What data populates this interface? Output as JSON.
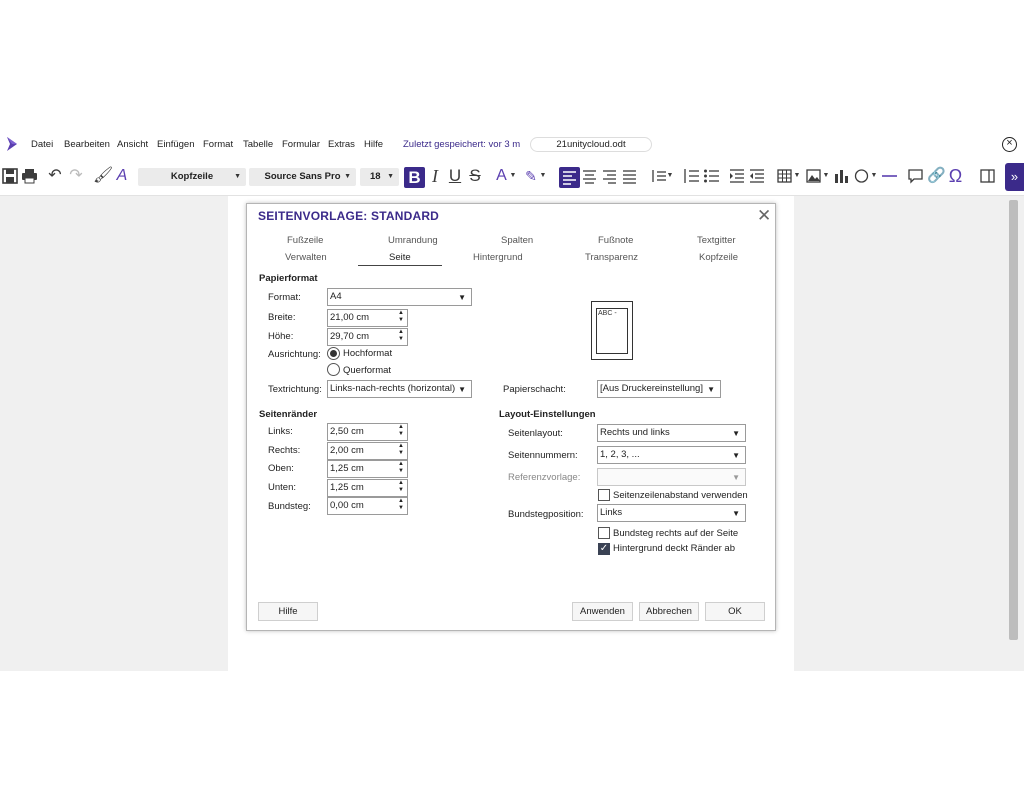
{
  "menubar": {
    "items": [
      "Datei",
      "Bearbeiten",
      "Ansicht",
      "Einfügen",
      "Format",
      "Tabelle",
      "Formular",
      "Extras",
      "Hilfe"
    ],
    "saved_status": "Zuletzt gespeichert: vor 3 m",
    "filename": "21unitycloud.odt"
  },
  "toolbar": {
    "paragraph_style": "Kopfzeile",
    "font_name": "Source Sans Pro",
    "font_size": "18",
    "bold_label": "B",
    "italic_label": "I",
    "underline_label": "U",
    "strike_label": "S",
    "font_color_label": "A",
    "special_char_label": "Ω",
    "accent_color": "#3b2a8a",
    "icons": [
      "save-icon",
      "print-icon",
      "undo-icon",
      "redo-icon",
      "clone-formatting-icon",
      "clear-formatting-icon",
      "font-color-icon",
      "highlight-icon",
      "align-left-icon",
      "align-center-icon",
      "align-right-icon",
      "justify-icon",
      "line-spacing-icon",
      "numbered-list-icon",
      "bullet-list-icon",
      "indent-increase-icon",
      "indent-decrease-icon",
      "table-icon",
      "image-icon",
      "chart-icon",
      "shape-icon",
      "line-icon",
      "comment-icon",
      "link-icon",
      "special-character-icon",
      "sidebar-icon",
      "expand-icon"
    ]
  },
  "dialog": {
    "title": "SEITENVORLAGE: STANDARD",
    "tabs_row1": [
      "Fußzeile",
      "Umrandung",
      "Spalten",
      "Fußnote",
      "Textgitter"
    ],
    "tabs_row2": [
      "Verwalten",
      "Seite",
      "Hintergrund",
      "Transparenz",
      "Kopfzeile"
    ],
    "active_tab": "Seite",
    "paper": {
      "heading": "Papierformat",
      "format_label": "Format:",
      "format_value": "A4",
      "width_label": "Breite:",
      "width_value": "21,00 cm",
      "height_label": "Höhe:",
      "height_value": "29,70 cm",
      "orientation_label": "Ausrichtung:",
      "portrait_label": "Hochformat",
      "landscape_label": "Querformat",
      "orientation_selected": "Hochformat",
      "text_direction_label": "Textrichtung:",
      "text_direction_value": "Links-nach-rechts (horizontal)",
      "paper_tray_label": "Papierschacht:",
      "paper_tray_value": "[Aus Druckereinstellung]",
      "preview_text": "ABC -"
    },
    "margins": {
      "heading": "Seitenränder",
      "left_label": "Links:",
      "left_value": "2,50 cm",
      "right_label": "Rechts:",
      "right_value": "2,00 cm",
      "top_label": "Oben:",
      "top_value": "1,25 cm",
      "bottom_label": "Unten:",
      "bottom_value": "1,25 cm",
      "gutter_label": "Bundsteg:",
      "gutter_value": "0,00 cm"
    },
    "layout": {
      "heading": "Layout-Einstellungen",
      "page_layout_label": "Seitenlayout:",
      "page_layout_value": "Rechts und links",
      "page_numbers_label": "Seitennummern:",
      "page_numbers_value": "1, 2, 3, ...",
      "reference_style_label": "Referenzvorlage:",
      "reference_style_value": "",
      "line_spacing_check_label": "Seitenzeilenabstand verwenden",
      "line_spacing_checked": false,
      "gutter_position_label": "Bundstegposition:",
      "gutter_position_value": "Links",
      "gutter_right_check_label": "Bundsteg rechts auf der Seite",
      "gutter_right_checked": false,
      "background_check_label": "Hintergrund deckt Ränder ab",
      "background_checked": true
    },
    "buttons": {
      "help": "Hilfe",
      "apply": "Anwenden",
      "cancel": "Abbrechen",
      "ok": "OK"
    }
  }
}
